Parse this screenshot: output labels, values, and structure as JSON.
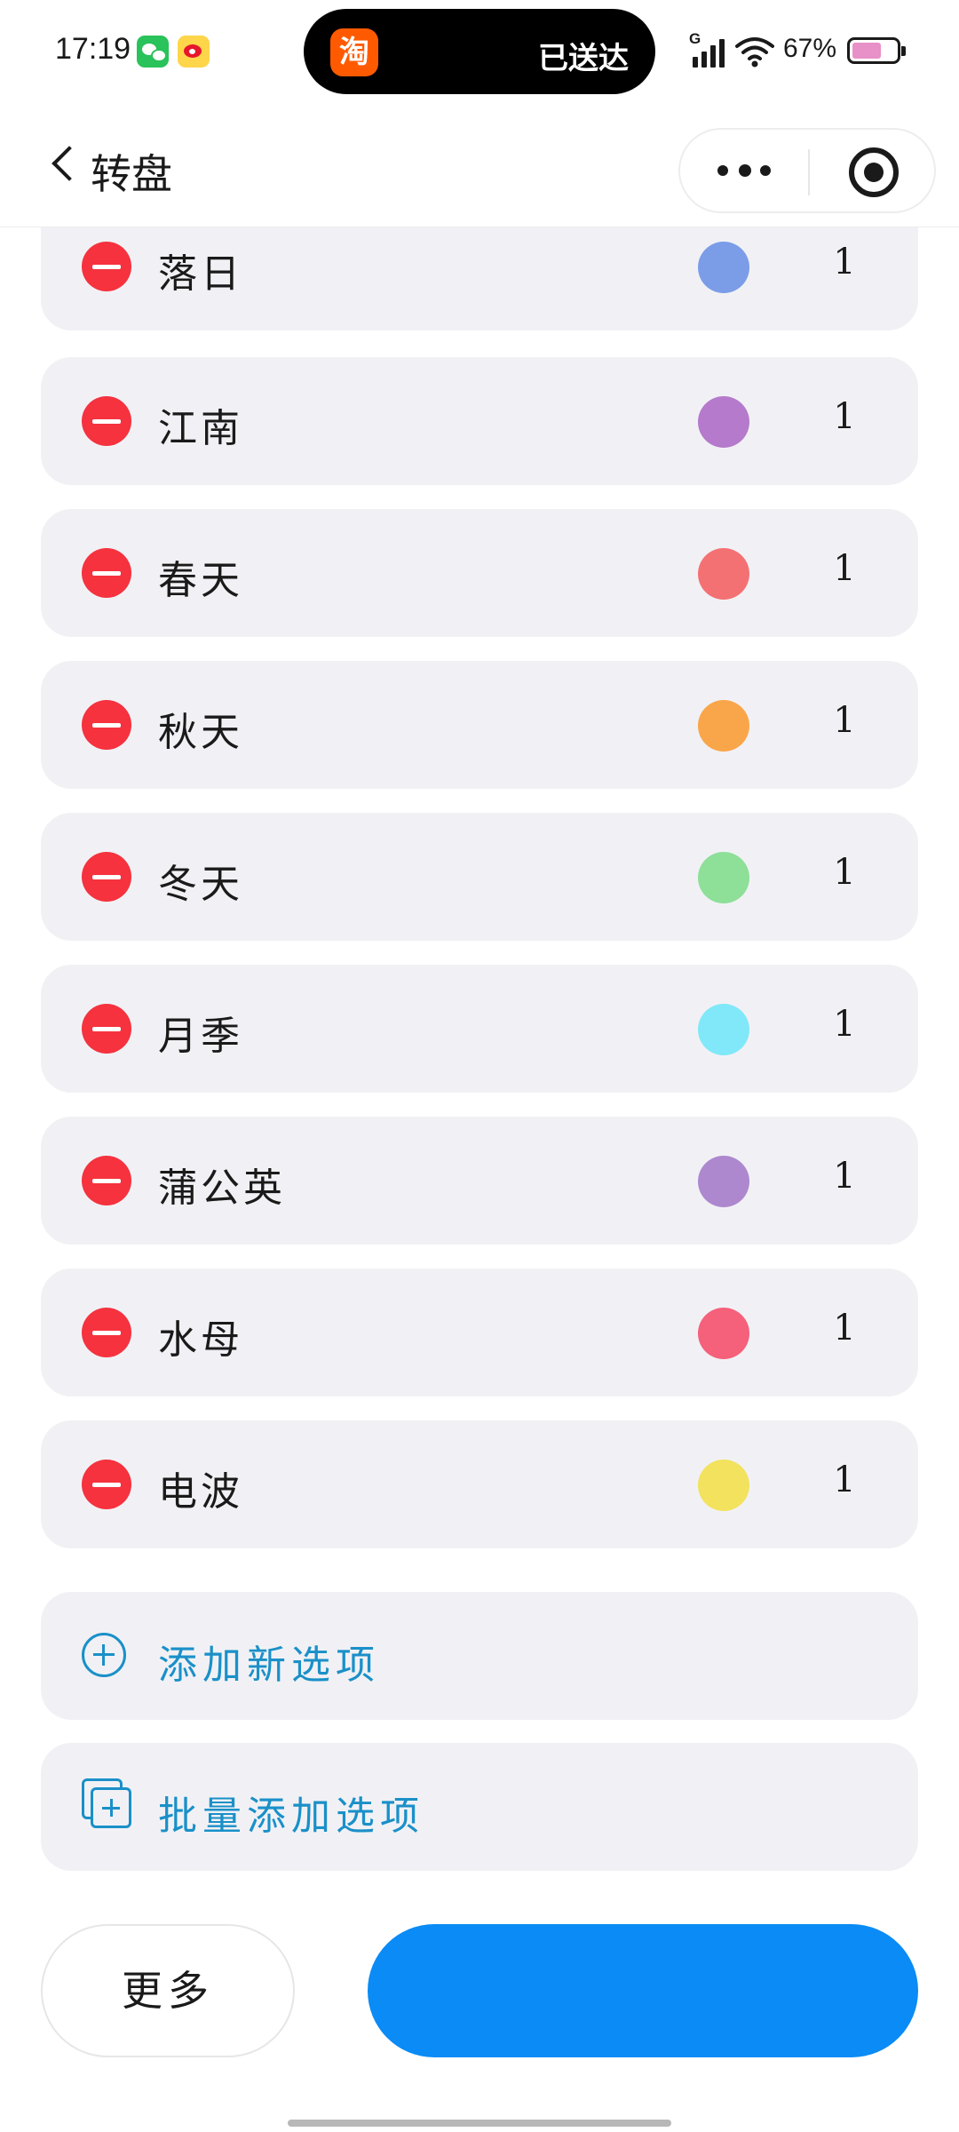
{
  "status_bar": {
    "time": "17:19",
    "island_app_glyph": "淘",
    "island_text": "已送达",
    "signal_label": "G",
    "battery_percent": "67%",
    "battery_level": 0.67
  },
  "nav": {
    "title": "转盘"
  },
  "items": [
    {
      "label": "落日",
      "color": "#7b9de8",
      "weight": "1"
    },
    {
      "label": "江南",
      "color": "#b57acb",
      "weight": "1"
    },
    {
      "label": "春天",
      "color": "#f47173",
      "weight": "1"
    },
    {
      "label": "秋天",
      "color": "#f9a64a",
      "weight": "1"
    },
    {
      "label": "冬天",
      "color": "#8edf98",
      "weight": "1"
    },
    {
      "label": "月季",
      "color": "#80e8f8",
      "weight": "1"
    },
    {
      "label": "蒲公英",
      "color": "#ad88cf",
      "weight": "1"
    },
    {
      "label": "水母",
      "color": "#f5607a",
      "weight": "1"
    },
    {
      "label": "电波",
      "color": "#f2e25e",
      "weight": "1"
    }
  ],
  "actions": {
    "add_new": "添加新选项",
    "batch_add": "批量添加选项"
  },
  "bottom": {
    "more_label": "更多"
  },
  "colors": {
    "accent": "#1a90c8",
    "primary_button": "#0a8bf5",
    "remove": "#f5323e",
    "row_bg": "#f1f1f5"
  }
}
